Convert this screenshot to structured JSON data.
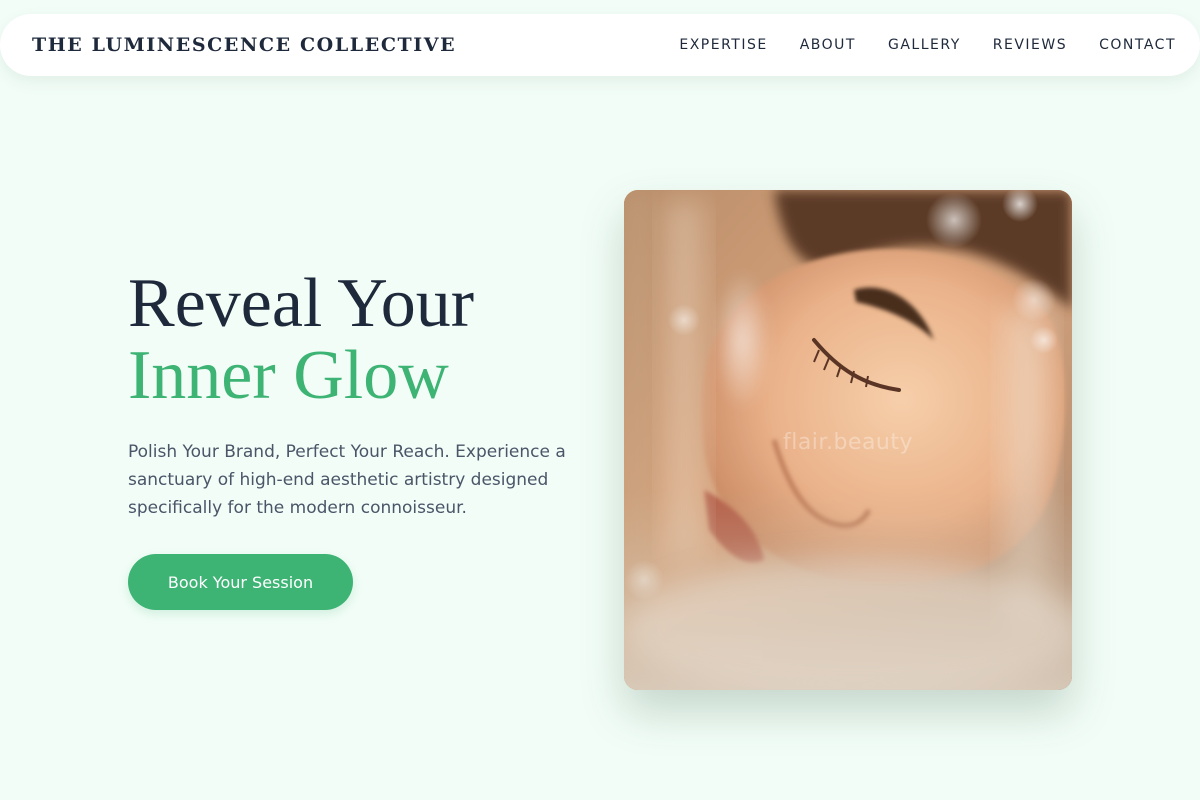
{
  "brand": {
    "name": "THE LUMINESCENCE COLLECTIVE"
  },
  "nav": {
    "items": [
      {
        "label": "EXPERTISE"
      },
      {
        "label": "ABOUT"
      },
      {
        "label": "GALLERY"
      },
      {
        "label": "REVIEWS"
      },
      {
        "label": "CONTACT"
      }
    ]
  },
  "hero": {
    "headline_line1": "Reveal Your",
    "headline_line2": "Inner Glow",
    "subtext": "Polish Your Brand, Perfect Your Reach. Experience a sanctuary of high-end aesthetic artistry designed specifically for the modern connoisseur.",
    "cta_label": "Book Your Session",
    "image_watermark": "flair.beauty"
  },
  "colors": {
    "background": "#f2fdf7",
    "accent": "#3db374",
    "text_dark": "#1e293b",
    "text_muted": "#4a5568"
  }
}
